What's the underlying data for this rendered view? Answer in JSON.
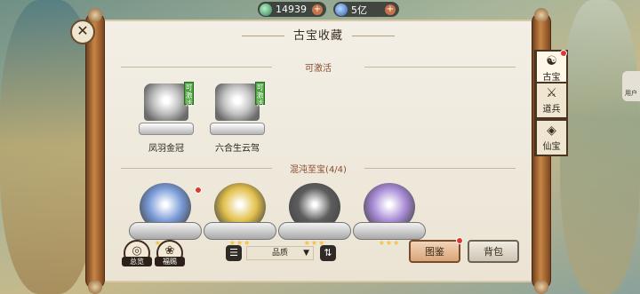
{
  "resources": [
    {
      "icon": "jade-icon",
      "value": "14939"
    },
    {
      "icon": "gem-icon",
      "value": "5亿"
    }
  ],
  "close_icon": "close-icon",
  "panel": {
    "title": "古宝收藏",
    "section_activatable": "可激活",
    "activatable_items": [
      {
        "name": "凤羽金冠",
        "tag": "可激活",
        "tone": "#bfbfbf"
      },
      {
        "name": "六合生云驾",
        "tag": "可激活",
        "tone": "#c4c4c4"
      }
    ],
    "section_chaos": "混沌至宝(4/4)",
    "chaos_items": [
      {
        "color": "#7a9bd8",
        "stars": "★★★",
        "has_dot": true
      },
      {
        "color": "#e2c04b",
        "stars": "★★★",
        "has_dot": false
      },
      {
        "color": "#5d5d5d",
        "stars": "★★★",
        "has_dot": false
      },
      {
        "color": "#a88bd6",
        "stars": "★★★",
        "has_dot": false
      }
    ]
  },
  "bottom": {
    "left_buttons": [
      {
        "label": "总览",
        "icon": "overview-icon"
      },
      {
        "label": "福赐",
        "icon": "blessing-icon"
      }
    ],
    "filter_icon": "list-icon",
    "quality_select": "品质",
    "sort_icon": "sort-icon",
    "primary_action": "图鉴",
    "secondary_action": "背包"
  },
  "side_tabs": [
    {
      "label": "古宝",
      "icon": "ancient-treasure-icon",
      "active": true
    },
    {
      "label": "道兵",
      "icon": "weapon-icon",
      "active": false
    },
    {
      "label": "仙宝",
      "icon": "immortal-treasure-icon",
      "active": false
    }
  ],
  "corner_user_label": "用户"
}
